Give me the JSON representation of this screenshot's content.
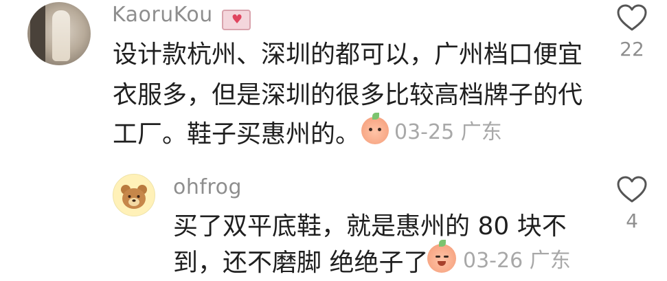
{
  "comments": [
    {
      "username": "KaoruKou",
      "badge_icon": "love-letter-icon",
      "lines": [
        "设计款杭州、深圳的都可以，广州档口便宜",
        "衣服多，但是深圳的很多比较高档牌子的代",
        "工厂。鞋子买惠州的。"
      ],
      "emoji": "peach-shy-emoji",
      "date": "03-25",
      "location": "广东",
      "likes": "22"
    }
  ],
  "replies": [
    {
      "username": "ohfrog",
      "lines": [
        "买了双平底鞋，就是惠州的 80 块不",
        "到，还不磨脚 绝绝子了"
      ],
      "emoji": "peach-cry-laugh-emoji",
      "date": "03-26",
      "location": "广东",
      "likes": "4"
    }
  ],
  "colors": {
    "text_primary": "#1f1f1f",
    "text_secondary": "#8e8e8e",
    "meta": "#a8a8a8",
    "background": "#ffffff"
  }
}
